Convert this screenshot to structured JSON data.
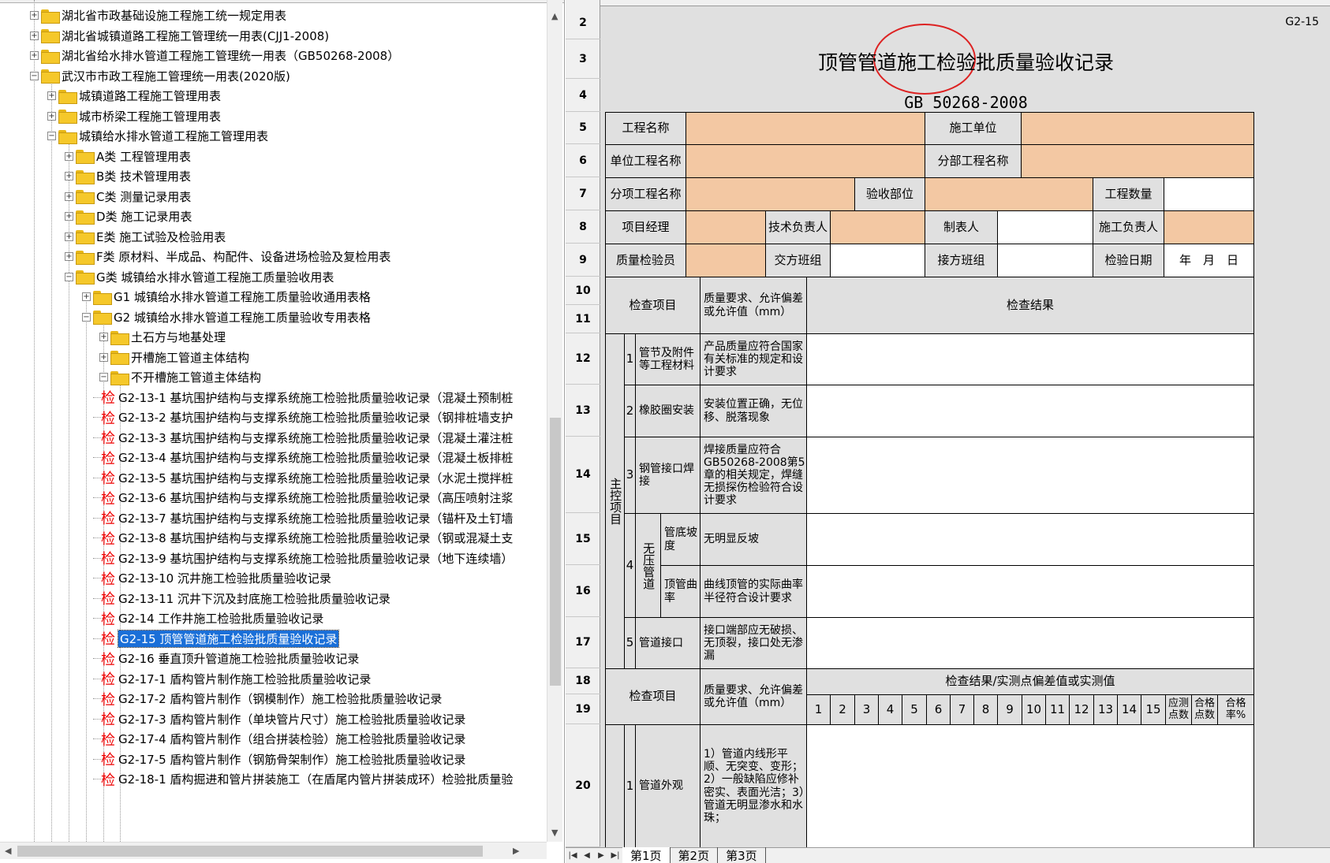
{
  "tree": {
    "nodes": [
      {
        "label": "湖北省市政基础设施工程施工统一规定用表",
        "kind": "folder",
        "level": 0,
        "expanded": false
      },
      {
        "label": "湖北省城镇道路工程施工管理统一用表(CJJ1-2008)",
        "kind": "folder",
        "level": 0,
        "expanded": false
      },
      {
        "label": "湖北省给水排水管道工程施工管理统一用表（GB50268-2008）",
        "kind": "folder",
        "level": 0,
        "expanded": false
      },
      {
        "label": "武汉市市政工程施工管理统一用表(2020版)",
        "kind": "folder",
        "level": 0,
        "expanded": true
      },
      {
        "label": "城镇道路工程施工管理用表",
        "kind": "folder",
        "level": 1,
        "expanded": false
      },
      {
        "label": "城市桥梁工程施工管理用表",
        "kind": "folder",
        "level": 1,
        "expanded": false
      },
      {
        "label": "城镇给水排水管道工程施工管理用表",
        "kind": "folder",
        "level": 1,
        "expanded": true
      },
      {
        "label": "A类 工程管理用表",
        "kind": "folder",
        "level": 2,
        "expanded": false
      },
      {
        "label": "B类 技术管理用表",
        "kind": "folder",
        "level": 2,
        "expanded": false
      },
      {
        "label": "C类 测量记录用表",
        "kind": "folder",
        "level": 2,
        "expanded": false
      },
      {
        "label": "D类 施工记录用表",
        "kind": "folder",
        "level": 2,
        "expanded": false
      },
      {
        "label": "E类 施工试验及检验用表",
        "kind": "folder",
        "level": 2,
        "expanded": false
      },
      {
        "label": "F类 原材料、半成品、构配件、设备进场检验及复检用表",
        "kind": "folder",
        "level": 2,
        "expanded": false
      },
      {
        "label": "G类 城镇给水排水管道工程施工质量验收用表",
        "kind": "folder",
        "level": 2,
        "expanded": true
      },
      {
        "label": "G1 城镇给水排水管道工程施工质量验收通用表格",
        "kind": "folder",
        "level": 3,
        "expanded": false
      },
      {
        "label": "G2 城镇给水排水管道工程施工质量验收专用表格",
        "kind": "folder",
        "level": 3,
        "expanded": true
      },
      {
        "label": "土石方与地基处理",
        "kind": "folder",
        "level": 4,
        "expanded": false
      },
      {
        "label": "开槽施工管道主体结构",
        "kind": "folder",
        "level": 4,
        "expanded": false
      },
      {
        "label": "不开槽施工管道主体结构",
        "kind": "folder",
        "level": 4,
        "expanded": true
      },
      {
        "label": "G2-13-1 基坑围护结构与支撑系统施工检验批质量验收记录（混凝土预制桩",
        "kind": "doc",
        "level": 5
      },
      {
        "label": "G2-13-2 基坑围护结构与支撑系统施工检验批质量验收记录（钢排桩墙支护",
        "kind": "doc",
        "level": 5
      },
      {
        "label": "G2-13-3 基坑围护结构与支撑系统施工检验批质量验收记录（混凝土灌注桩",
        "kind": "doc",
        "level": 5
      },
      {
        "label": "G2-13-4 基坑围护结构与支撑系统施工检验批质量验收记录（混凝土板排桩",
        "kind": "doc",
        "level": 5
      },
      {
        "label": "G2-13-5 基坑围护结构与支撑系统施工检验批质量验收记录（水泥土搅拌桩",
        "kind": "doc",
        "level": 5
      },
      {
        "label": "G2-13-6 基坑围护结构与支撑系统施工检验批质量验收记录（高压喷射注浆",
        "kind": "doc",
        "level": 5
      },
      {
        "label": "G2-13-7 基坑围护结构与支撑系统施工检验批质量验收记录（锚杆及土钉墙",
        "kind": "doc",
        "level": 5
      },
      {
        "label": "G2-13-8 基坑围护结构与支撑系统施工检验批质量验收记录（钢或混凝土支",
        "kind": "doc",
        "level": 5
      },
      {
        "label": "G2-13-9 基坑围护结构与支撑系统施工检验批质量验收记录（地下连续墙）",
        "kind": "doc",
        "level": 5
      },
      {
        "label": "G2-13-10 沉井施工检验批质量验收记录",
        "kind": "doc",
        "level": 5
      },
      {
        "label": "G2-13-11 沉井下沉及封底施工检验批质量验收记录",
        "kind": "doc",
        "level": 5
      },
      {
        "label": "G2-14 工作井施工检验批质量验收记录",
        "kind": "doc",
        "level": 5
      },
      {
        "label": "G2-15 顶管管道施工检验批质量验收记录",
        "kind": "doc",
        "level": 5,
        "selected": true
      },
      {
        "label": "G2-16 垂直顶升管道施工检验批质量验收记录",
        "kind": "doc",
        "level": 5
      },
      {
        "label": "G2-17-1 盾构管片制作施工检验批质量验收记录",
        "kind": "doc",
        "level": 5
      },
      {
        "label": "G2-17-2 盾构管片制作（钢模制作）施工检验批质量验收记录",
        "kind": "doc",
        "level": 5
      },
      {
        "label": "G2-17-3 盾构管片制作（单块管片尺寸）施工检验批质量验收记录",
        "kind": "doc",
        "level": 5
      },
      {
        "label": "G2-17-4 盾构管片制作（组合拼装检验）施工检验批质量验收记录",
        "kind": "doc",
        "level": 5
      },
      {
        "label": "G2-17-5 盾构管片制作（钢筋骨架制作）施工检验批质量验收记录",
        "kind": "doc",
        "level": 5
      },
      {
        "label": "G2-18-1 盾构掘进和管片拼装施工（在盾尾内管片拼装成环）检验批质量验",
        "kind": "doc",
        "level": 5
      }
    ],
    "doc_icon_char": "检"
  },
  "sheet": {
    "row_numbers": [
      "2",
      "3",
      "4",
      "5",
      "6",
      "7",
      "8",
      "9",
      "10",
      "11",
      "12",
      "13",
      "14",
      "15",
      "16",
      "17",
      "18",
      "19",
      "20"
    ],
    "code": "G2-15",
    "title": "顶管管道施工检验批质量验收记录",
    "standard": "GB 50268-2008",
    "labels": {
      "project_name": "工程名称",
      "contractor": "施工单位",
      "unit_project": "单位工程名称",
      "division": "分部工程名称",
      "sub_item": "分项工程名称",
      "location": "验收部位",
      "quantity": "工程数量",
      "pm": "项目经理",
      "tech_lead": "技术负责人",
      "maker": "制表人",
      "construction_lead": "施工负责人",
      "inspector": "质量检验员",
      "handover": "交方班组",
      "receiver": "接方班组",
      "date_label": "检验日期",
      "date_value": "年　月　日",
      "check_item": "检查项目",
      "requirement": "质量要求、允许偏差或允许值（mm）",
      "result": "检查结果",
      "main_control": "主控项目",
      "result_measured": "检查结果/实测点偏差值或实测值",
      "check_item2": "检查项目",
      "requirement2": "质量要求、允许偏差或允许值（mm）",
      "measured_points": "应测点数",
      "pass_points": "合格点数",
      "pass_rate": "合格率%"
    },
    "main_items": [
      {
        "no": "1",
        "name": "管节及附件等工程材料",
        "req": "产品质量应符合国家有关标准的规定和设计要求"
      },
      {
        "no": "2",
        "name": "橡胶圈安装",
        "req": "安装位置正确，无位移、脱落现象"
      },
      {
        "no": "3",
        "name": "钢管接口焊接",
        "req": "焊接质量应符合GB50268-2008第5章的相关规定，焊缝无损探伤检验符合设计要求"
      },
      {
        "no": "4",
        "group": "无压管道",
        "sub": [
          {
            "name": "管底坡度",
            "req": "无明显反坡"
          },
          {
            "name": "顶管曲率",
            "req": "曲线顶管的实际曲率半径符合设计要求"
          }
        ]
      },
      {
        "no": "5",
        "name": "管道接口",
        "req": "接口端部应无破损、无顶裂，接口处无渗漏"
      }
    ],
    "point_cols": [
      "1",
      "2",
      "3",
      "4",
      "5",
      "6",
      "7",
      "8",
      "9",
      "10",
      "11",
      "12",
      "13",
      "14",
      "15"
    ],
    "general_item": {
      "no": "1",
      "name": "管道外观",
      "req": "1）管道内线形平顺、无突变、变形；2）一般缺陷应修补密实、表面光洁；3）管道无明显渗水和水珠；"
    }
  },
  "tabs": [
    "第1页",
    "第2页",
    "第3页"
  ],
  "colors": {
    "peach": "#f3c8a3",
    "selection": "#1a6fd8",
    "stamp": "#d22222"
  }
}
